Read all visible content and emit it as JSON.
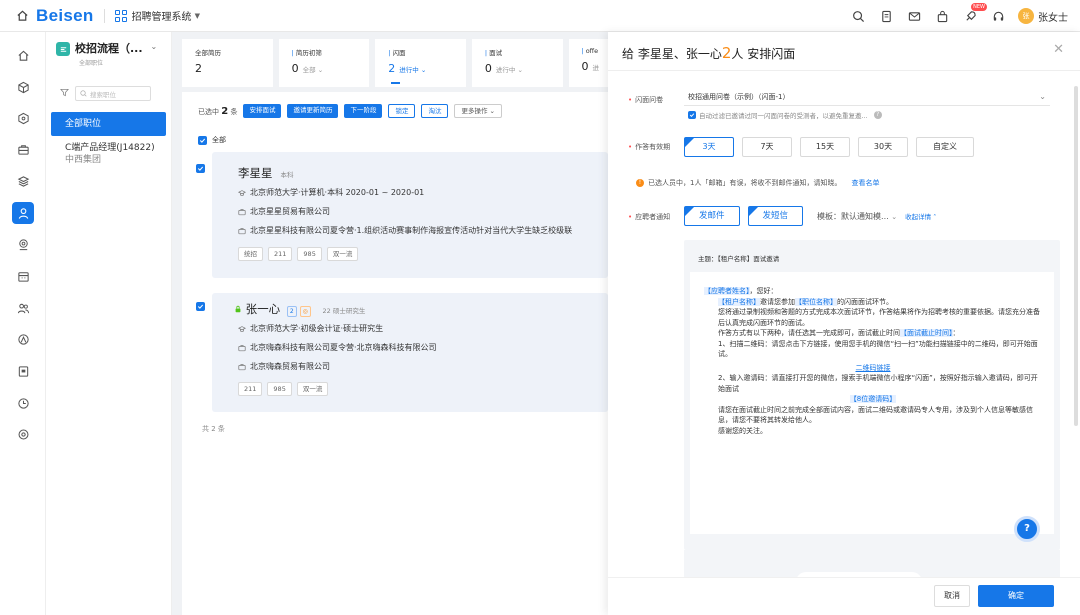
{
  "topbar": {
    "logo": "Beisen",
    "app_name": "招聘管理系统",
    "new_badge": "NEW",
    "avatar_text": "张",
    "user_name": "张女士"
  },
  "sidebar": {
    "process_title": "校招流程（...",
    "process_sub": "全部职位",
    "search_placeholder": "搜索职位",
    "all_positions": "全部职位",
    "position_name": "C端产品经理(J14822)",
    "position_org": "中西集团"
  },
  "stats": [
    {
      "label": "全部简历",
      "value": "2",
      "sub": "",
      "active": false
    },
    {
      "label": "简历初筛",
      "value": "0",
      "sub": "全部",
      "active": false
    },
    {
      "label": "闪面",
      "value": "2",
      "sub": "进行中",
      "active": true
    },
    {
      "label": "面试",
      "value": "0",
      "sub": "进行中",
      "active": false
    },
    {
      "label": "offe",
      "value": "0",
      "sub": "进",
      "active": false
    }
  ],
  "toolbar": {
    "selected_prefix": "已选中",
    "selected_count": "2",
    "selected_suffix": "条",
    "btn_schedule": "安排面试",
    "btn_invite_update": "邀请更新简历",
    "btn_next_stage": "下一阶段",
    "btn_lock": "锁定",
    "btn_eliminate": "淘汰",
    "btn_more": "更多操作"
  },
  "list": {
    "select_all": "全部",
    "total": "共 2 条",
    "candidates": [
      {
        "name": "李星星",
        "degree": "本科",
        "education": "北京师范大学·计算机·本科   2020-01 ~ 2020-01",
        "company1": "北京星星贸易有限公司",
        "company2": "北京星星科技有限公司夏令营·1.组织活动赛事制作海报宣传活动针对当代大学生缺乏校级联",
        "tags": [
          "统招",
          "211",
          "985",
          "双一流"
        ]
      },
      {
        "name": "张一心",
        "badge1": "2",
        "badge2": "◎",
        "extra": "22  硕士研究生",
        "education": "北京师范大学·初级会计证·硕士研究生",
        "company1": "北京嗨森科技有限公司夏令营·北京嗨森科技有限公司",
        "company2": "北京嗨森贸易有限公司",
        "tags": [
          "211",
          "985",
          "双一流"
        ]
      }
    ]
  },
  "drawer": {
    "title_prefix": "给 李星星、张一心",
    "title_count": "2",
    "title_suffix": "人 安排闪面",
    "questionnaire_label": "闪面问卷",
    "questionnaire_value": "校招通用问卷（示例）（闪面-1）",
    "filter_note": "自动过滤已邀请过同一闪面问卷的受测者，以避免重复邀...",
    "validity_label": "作答有效期",
    "validity_options": [
      "3天",
      "7天",
      "15天",
      "30天",
      "自定义"
    ],
    "warning_text": "已选人员中，1人「邮箱」有误，将收不到邮件通知，请知晓。",
    "warning_link": "查看名单",
    "notify_label": "应聘者通知",
    "notify_email": "发邮件",
    "notify_sms": "发短信",
    "template_text": "模板：默认通知模...",
    "collapse_text": "收起详情",
    "mail_subject": "主题：【租户名称】面试邀请",
    "mail_greeting_hl": "【应聘者姓名】",
    "mail_greeting_rest": "，您好：",
    "mail_p1_hl1": "【租户名称】",
    "mail_p1_mid": "邀请您参加",
    "mail_p1_hl2": "【职位名称】",
    "mail_p1_end": "的闪面面试环节。",
    "mail_p2": "您将通过录制视频和答题的方式完成本次面试环节，作答结果将作为招聘考核的重要依据。请您充分准备后认真完成闪面环节的面试。",
    "mail_p3_start": "作答方式有以下两种，请任选其一完成即可，面试截止时间",
    "mail_p3_hl": "【面试截止时间】",
    "mail_p3_end": "：",
    "mail_p4": "1、扫描二维码：请您点击下方链接，使用您手机的微信“扫一扫”功能扫描链接中的二维码，即可开始面试。",
    "mail_qr_link": "二维码链接",
    "mail_p5": "2、输入邀请码：请直接打开您的微信，搜索手机端微信小程序“闪面”，按照好指示输入邀请码，即可开始面试",
    "mail_code_hl": "【8位邀请码】",
    "mail_p6": "请您在面试截止时间之前完成全部面试内容，面试二维码或邀请码专人专用，涉及到个人信息等敏感信息，请您不要将其转发给他人。",
    "mail_p7": "感谢您的关注。",
    "help_fab": "?",
    "btn_cancel": "取消",
    "btn_confirm": "确定"
  },
  "colors": {
    "primary": "#1677e8",
    "accent_orange": "#fa8c16",
    "teal": "#2fb5a8"
  }
}
